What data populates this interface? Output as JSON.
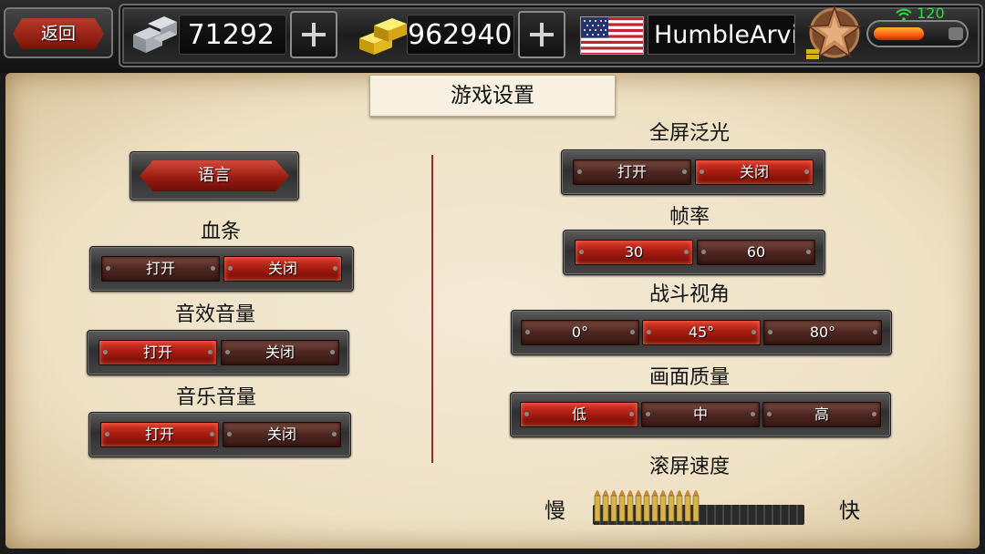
{
  "topbar": {
    "back_label": "返回",
    "silver": "71292",
    "gold": "962940",
    "player_name": "HumbleArvin",
    "signal_value": "120",
    "energy_level": 0.72
  },
  "page": {
    "title": "游戏设置"
  },
  "left": {
    "language_label": "语言",
    "health_bar": {
      "label": "血条",
      "on": "打开",
      "off": "关闭",
      "selected": "off"
    },
    "sound_volume": {
      "label": "音效音量",
      "on": "打开",
      "off": "关闭",
      "selected": "on"
    },
    "music_volume": {
      "label": "音乐音量",
      "on": "打开",
      "off": "关闭",
      "selected": "on"
    }
  },
  "right": {
    "bloom": {
      "label": "全屏泛光",
      "options": [
        "打开",
        "关闭"
      ],
      "selected": 1
    },
    "frame_rate": {
      "label": "帧率",
      "options": [
        "30",
        "60"
      ],
      "selected": 0
    },
    "camera_angle": {
      "label": "战斗视角",
      "options": [
        "0°",
        "45°",
        "80°"
      ],
      "selected": 1
    },
    "quality": {
      "label": "画面质量",
      "options": [
        "低",
        "中",
        "高"
      ],
      "selected": 0
    },
    "scroll_speed": {
      "label": "滚屏速度",
      "slow": "慢",
      "fast": "快",
      "level": 0.5
    }
  },
  "colors": {
    "active_red": "#c22a1c",
    "parchment": "#efe2c6",
    "accent_green": "#27e43a"
  },
  "icons": {
    "silver": "silver-ingots-icon",
    "gold": "gold-bars-icon",
    "flag": "us-flag-icon",
    "rank": "star-rank-badge-icon",
    "signal": "wifi-icon"
  }
}
